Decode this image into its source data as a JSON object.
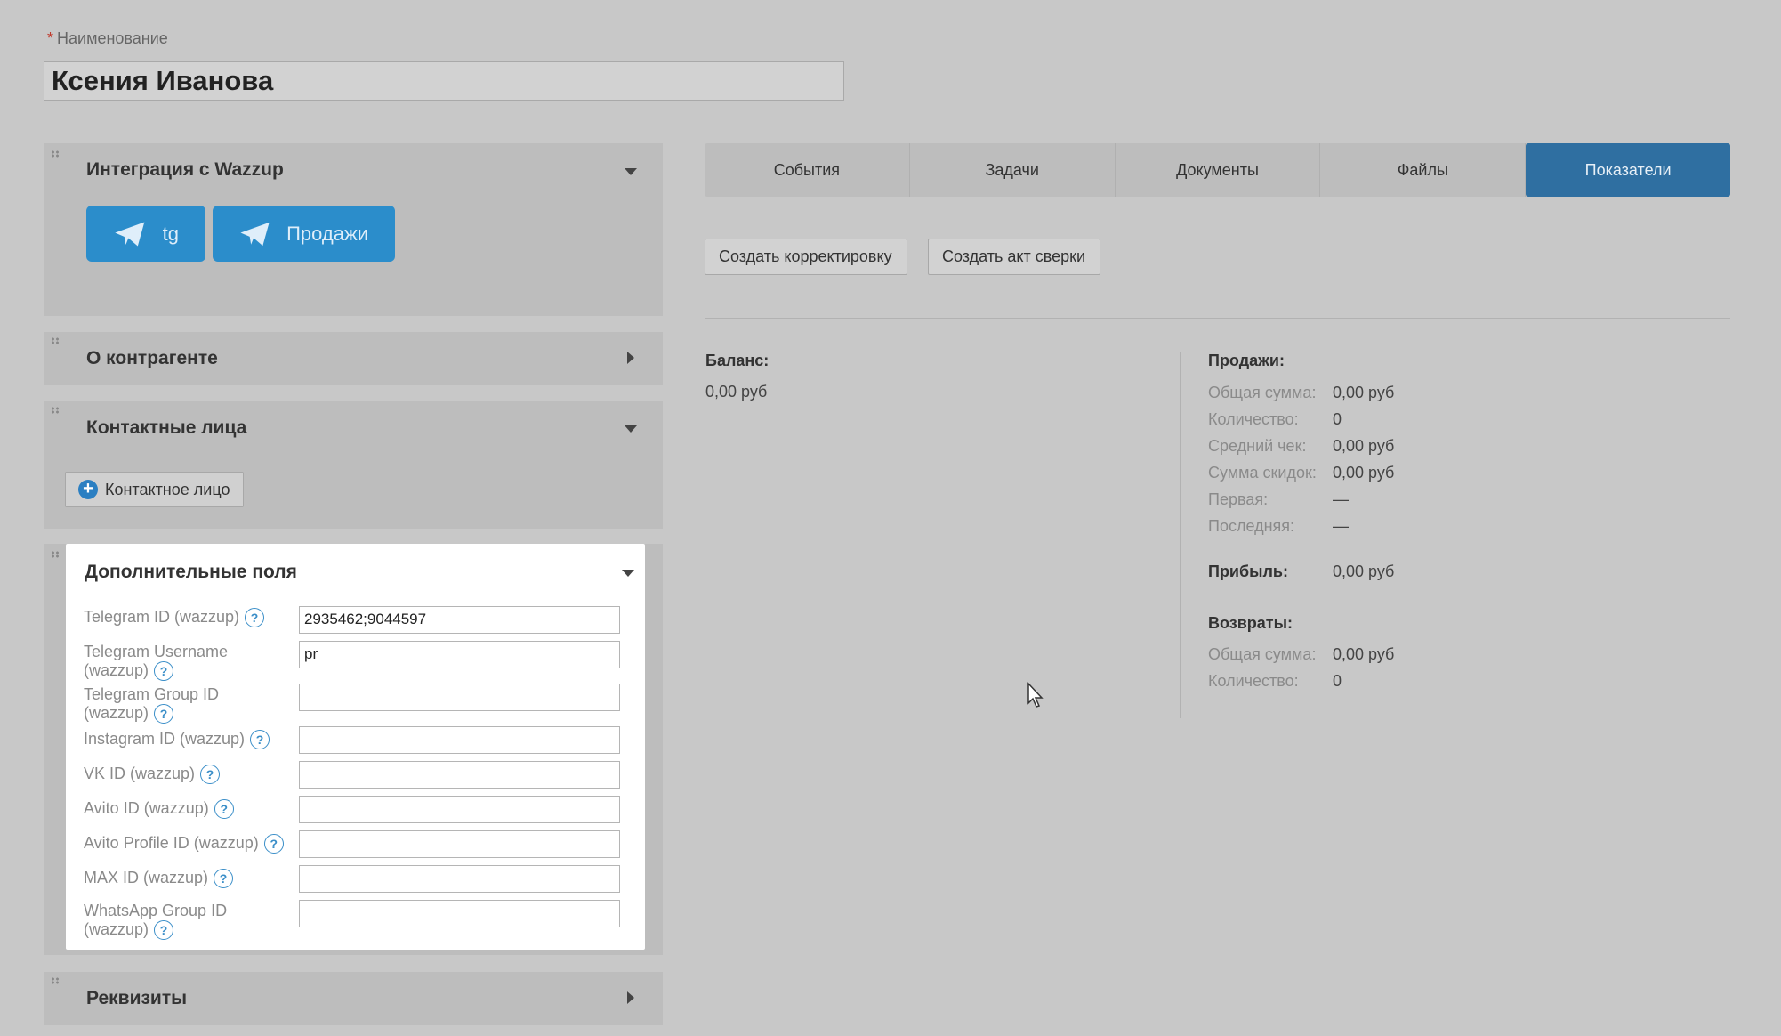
{
  "name_field": {
    "label": "Наименование",
    "required_mark": "*",
    "value": "Ксения Иванова"
  },
  "wazzup_panel": {
    "title": "Интеграция с Wazzup",
    "buttons": [
      {
        "label": "tg"
      },
      {
        "label": "Продажи"
      }
    ]
  },
  "about_panel": {
    "title": "О контрагенте"
  },
  "contacts_panel": {
    "title": "Контактные лица",
    "add_label": "Контактное лицо"
  },
  "extra_panel": {
    "title": "Дополнительные поля",
    "help_glyph": "?",
    "fields": [
      {
        "label": "Telegram ID (wazzup)",
        "value": "2935462;9044597"
      },
      {
        "label": "Telegram Username (wazzup)",
        "value": "pr"
      },
      {
        "label": "Telegram Group ID (wazzup)",
        "value": ""
      },
      {
        "label": "Instagram ID (wazzup)",
        "value": ""
      },
      {
        "label": "VK ID (wazzup)",
        "value": ""
      },
      {
        "label": "Avito ID (wazzup)",
        "value": ""
      },
      {
        "label": "Avito Profile ID (wazzup)",
        "value": ""
      },
      {
        "label": "MAX ID (wazzup)",
        "value": ""
      },
      {
        "label": "WhatsApp Group ID (wazzup)",
        "value": ""
      }
    ]
  },
  "requisites_panel": {
    "title": "Реквизиты"
  },
  "tabs": [
    {
      "label": "События",
      "active": false
    },
    {
      "label": "Задачи",
      "active": false
    },
    {
      "label": "Документы",
      "active": false
    },
    {
      "label": "Файлы",
      "active": false
    },
    {
      "label": "Показатели",
      "active": true
    }
  ],
  "actions": {
    "correction": "Создать корректировку",
    "reconciliation": "Создать акт сверки"
  },
  "balance": {
    "title": "Баланс:",
    "value": "0,00  руб"
  },
  "sales": {
    "title": "Продажи:",
    "rows": [
      {
        "label": "Общая сумма:",
        "value": "0,00  руб"
      },
      {
        "label": "Количество:",
        "value": "0"
      },
      {
        "label": "Средний чек:",
        "value": "0,00  руб"
      },
      {
        "label": "Сумма скидок:",
        "value": "0,00  руб"
      },
      {
        "label": "Первая:",
        "value": "—"
      },
      {
        "label": "Последняя:",
        "value": "—"
      }
    ]
  },
  "profit": {
    "title": "Прибыль:",
    "value": "0,00  руб"
  },
  "returns": {
    "title": "Возвраты:",
    "rows": [
      {
        "label": "Общая сумма:",
        "value": "0,00  руб"
      },
      {
        "label": "Количество:",
        "value": "0"
      }
    ]
  },
  "colors": {
    "accent": "#2b8dcb",
    "active_tab": "#2f6fa1",
    "background": "#c8c8c8"
  }
}
